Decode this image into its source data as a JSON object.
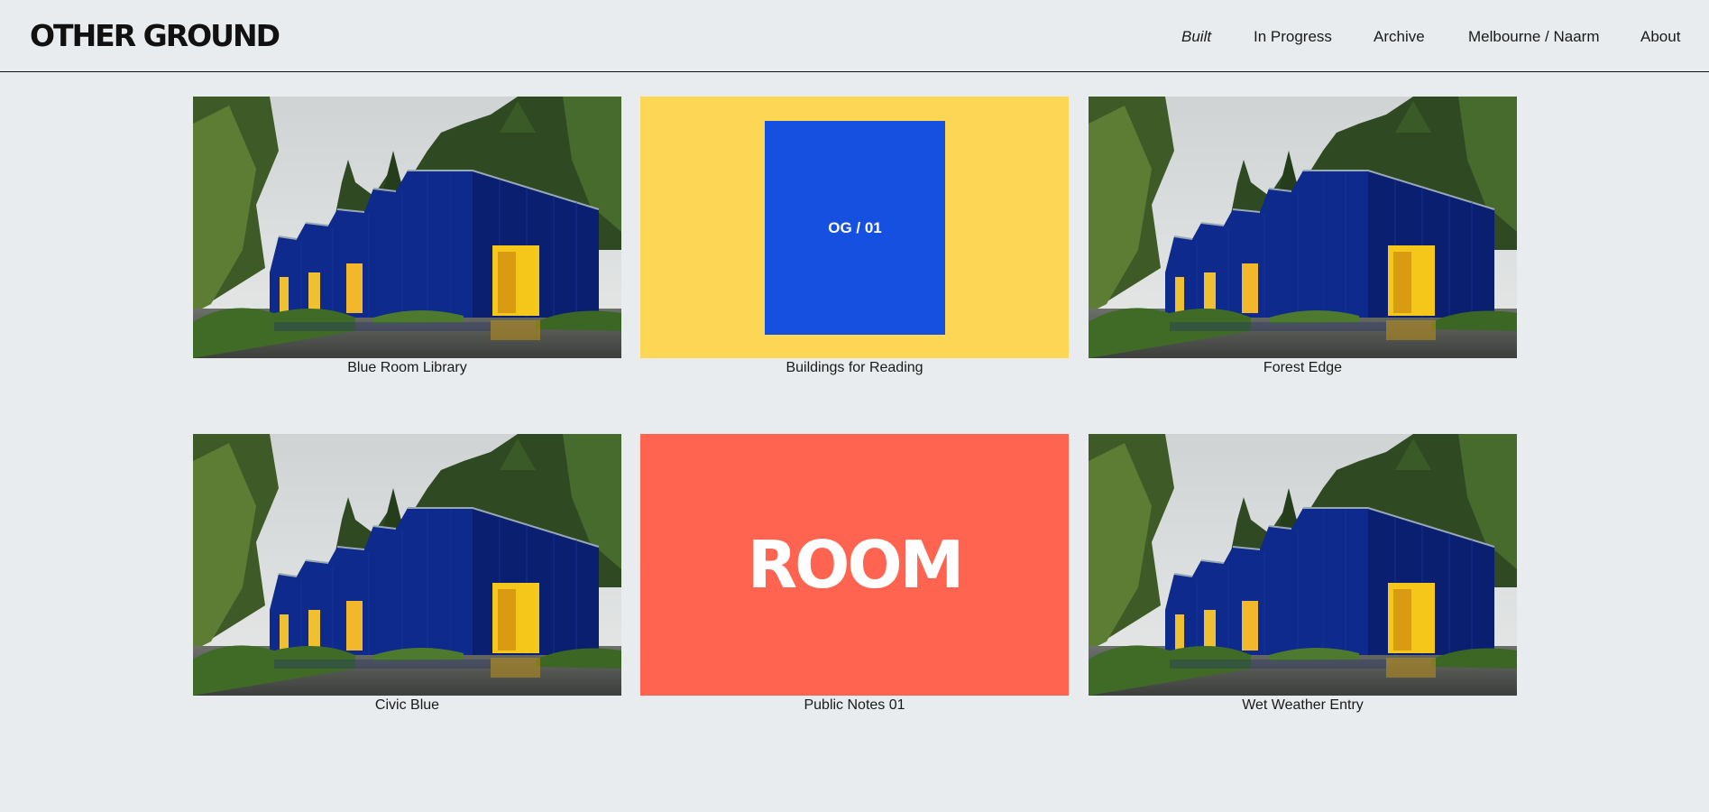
{
  "site": {
    "logo": "OTHER GROUND"
  },
  "nav": {
    "built": "Built",
    "in_progress": "In Progress",
    "archive": "Archive",
    "location": "Melbourne / Naarm",
    "about": "About",
    "active": "Built"
  },
  "projects": [
    {
      "title": "Blue Room Library",
      "thumb": "photo"
    },
    {
      "title": "Buildings for Reading",
      "thumb": "graphic",
      "graphic_text": "OG / 01",
      "colors": {
        "bg": "#fdd655",
        "square": "#1650e0"
      }
    },
    {
      "title": "Forest Edge",
      "thumb": "photo"
    },
    {
      "title": "Civic Blue",
      "thumb": "photo"
    },
    {
      "title": "Public Notes 01",
      "thumb": "graphic",
      "graphic_text": "ROOM",
      "colors": {
        "bg": "#ff6450"
      }
    },
    {
      "title": "Wet Weather Entry",
      "thumb": "photo"
    }
  ],
  "colors": {
    "page_bg": "#e8ecee",
    "building_blue": "#0e2a8c",
    "door_yellow": "#f5c71a"
  }
}
